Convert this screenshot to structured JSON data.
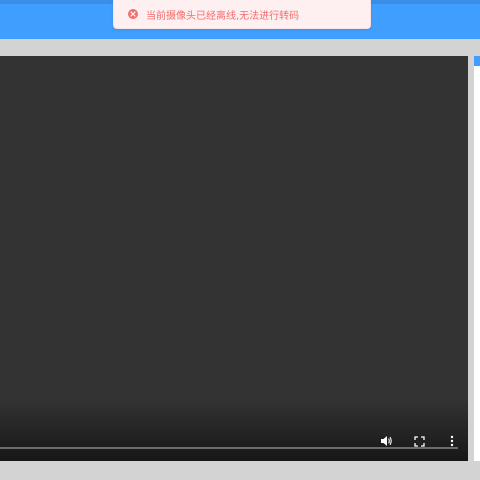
{
  "toast": {
    "type": "error",
    "icon": "error-circle-icon",
    "message": "当前摄像头已经离线,无法进行转码"
  },
  "player": {
    "icons": {
      "volume": "volume-icon",
      "fullscreen": "fullscreen-icon",
      "more": "more-vertical-icon"
    },
    "progress": 0
  },
  "colors": {
    "topbar": "#409eff",
    "player_background": "#333333",
    "page_background": "#d3d3d3",
    "toast_background": "#fef0f0",
    "toast_text": "#f56c6c"
  }
}
